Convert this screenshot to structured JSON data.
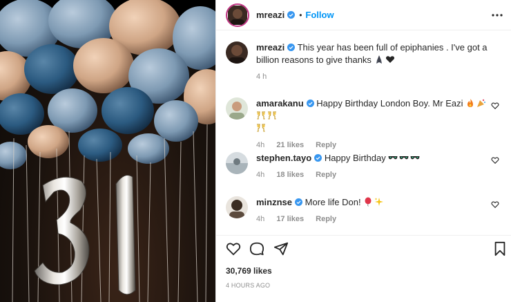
{
  "post": {
    "author": "mreazi",
    "follow_label": "Follow",
    "dot": "•",
    "caption": {
      "username": "mreazi",
      "text": "This year has been full of epiphanies . I've got a billion reasons to give thanks",
      "emojis": [
        "folded-hands-emoji",
        "black-heart-emoji"
      ],
      "time": "4 h"
    },
    "comments": [
      {
        "username": "amarakanu",
        "text": "Happy Birthday London Boy. Mr Eazi",
        "emojis": [
          "fire-emoji",
          "party-popper-emoji",
          "clinking-glasses-emoji",
          "clinking-glasses-emoji",
          "clinking-glasses-emoji"
        ],
        "time": "4h",
        "likes": "21 likes",
        "reply": "Reply"
      },
      {
        "username": "stephen.tayo",
        "text": "Happy Birthday",
        "emojis": [
          "sunglasses-emoji",
          "sunglasses-emoji",
          "sunglasses-emoji"
        ],
        "time": "4h",
        "likes": "18 likes",
        "reply": "Reply"
      },
      {
        "username": "minznse",
        "text": "More life Don!",
        "emojis": [
          "balloon-emoji",
          "sparkles-emoji"
        ],
        "time": "4h",
        "likes": "17 likes",
        "reply": "Reply"
      }
    ],
    "likes_total": "30,769 likes",
    "posted_ago": "4 HOURS AGO"
  },
  "colors": {
    "follow_blue": "#0095f6",
    "verified_blue": "#3897f0",
    "muted_gray": "#8e8e8e",
    "text_dark": "#262626",
    "story_ring": "#c13584"
  },
  "icons": {
    "verified": "verified-badge-icon",
    "more": "more-options-icon",
    "like": "heart-icon",
    "comment": "comment-bubble-icon",
    "share": "paper-plane-icon",
    "save": "bookmark-icon"
  }
}
